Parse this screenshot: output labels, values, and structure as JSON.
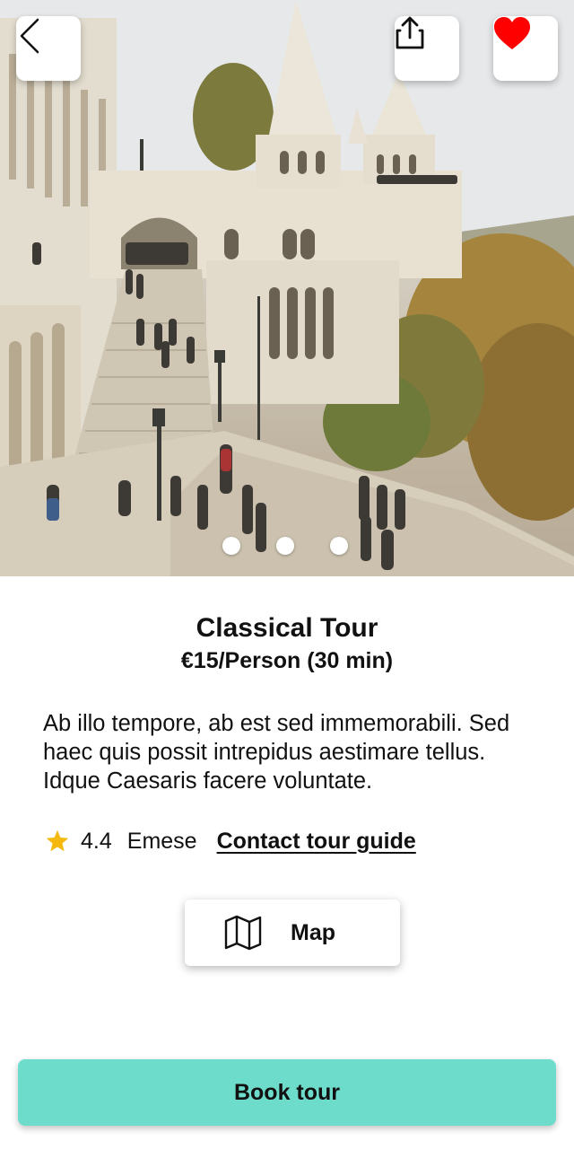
{
  "hero": {
    "image": "fishermans-bastion-photo",
    "slide_count": 3,
    "active_slide": 1
  },
  "header": {
    "back_icon": "chevron-left-icon",
    "share_icon": "share-icon",
    "favorite_icon": "heart-icon",
    "favorite_color": "#ff0000"
  },
  "tour": {
    "title": "Classical Tour",
    "price": "€15/Person (30 min)",
    "description": "Ab illo tempore, ab est sed immemorabili. Sed haec quis possit intrepidus aestimare tellus. Idque Caesaris facere voluntate.",
    "rating": "4.4",
    "star_color": "#f5b80c",
    "guide_name": "Emese",
    "contact_label": "Contact tour guide"
  },
  "map_button": {
    "label": "Map",
    "icon": "map-icon"
  },
  "book_button": {
    "label": "Book tour",
    "color": "#6ddccb"
  }
}
